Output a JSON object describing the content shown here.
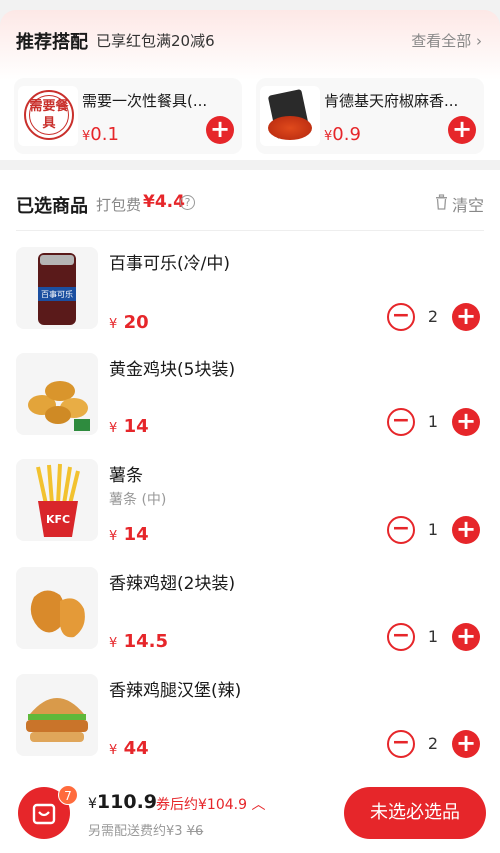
{
  "recommend": {
    "title": "推荐搭配",
    "subtitle": "已享红包满20减6",
    "see_all": "查看全部",
    "items": [
      {
        "name": "需要一次性餐具(...",
        "price_symbol": "¥",
        "price": "0.1",
        "stamp_text": "需要餐具"
      },
      {
        "name": "肯德基天府椒麻香...",
        "price_symbol": "¥",
        "price": "0.9"
      }
    ]
  },
  "selected": {
    "title": "已选商品",
    "pack_label": "打包费",
    "pack_fee": "¥4.4",
    "help": "?",
    "clear": "清空",
    "items": [
      {
        "name": "百事可乐(冷/中)",
        "spec": "",
        "price_symbol": "¥",
        "price": "20",
        "qty": "2",
        "can_label": "百事可乐"
      },
      {
        "name": "黄金鸡块(5块装)",
        "spec": "",
        "price_symbol": "¥",
        "price": "14",
        "qty": "1"
      },
      {
        "name": "薯条",
        "spec": "薯条 (中)",
        "price_symbol": "¥",
        "price": "14",
        "qty": "1",
        "box_label": "KFC"
      },
      {
        "name": "香辣鸡翅(2块装)",
        "spec": "",
        "price_symbol": "¥",
        "price": "14.5",
        "qty": "1"
      },
      {
        "name": "香辣鸡腿汉堡(辣)",
        "spec": "",
        "price_symbol": "¥",
        "price": "44",
        "qty": "2"
      }
    ]
  },
  "bottom": {
    "cart_count": "7",
    "total_symbol": "¥",
    "total": "110.9",
    "after_coupon": "券后约¥104.9",
    "delivery_text": "另需配送费约¥3",
    "delivery_original": "¥6",
    "checkout": "未选必选品"
  },
  "colors": {
    "accent": "#e6262a",
    "badge": "#ff6b3d"
  }
}
